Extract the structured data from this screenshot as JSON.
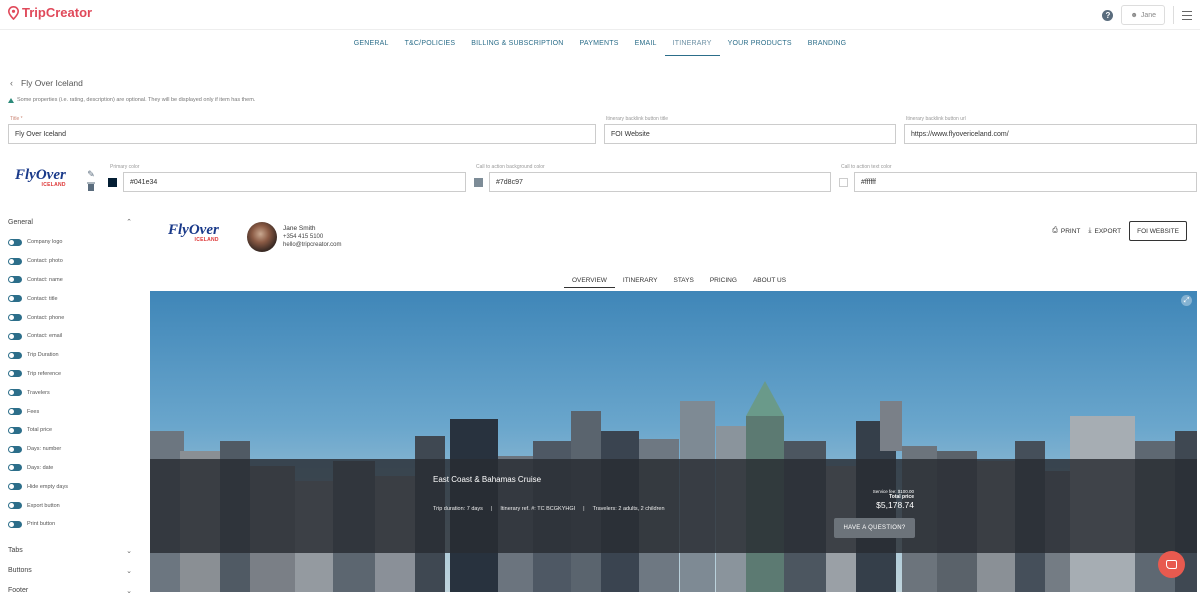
{
  "app": {
    "name": "TripCreator",
    "user": "Jane"
  },
  "nav": {
    "tabs": [
      "GENERAL",
      "T&C/POLICIES",
      "BILLING & SUBSCRIPTION",
      "PAYMENTS",
      "EMAIL",
      "ITINERARY",
      "YOUR PRODUCTS",
      "BRANDING"
    ],
    "active": "ITINERARY"
  },
  "page": {
    "title": "Fly Over Iceland",
    "note": "Some properties (i.e. rating, description) are optional. They will be displayed only if item has them."
  },
  "fields": {
    "title_label": "Title *",
    "title_value": "Fly Over Iceland",
    "backlink_title_label": "Itinerary backlink button title",
    "backlink_title_value": "FOI Website",
    "backlink_url_label": "Itinerary backlink button url",
    "backlink_url_value": "https://www.flyovericeland.com/",
    "primary_color_label": "Primary color",
    "primary_color_value": "#041e34",
    "cta_bg_label": "Call to action background color",
    "cta_bg_value": "#7d8c97",
    "cta_text_label": "Call to action text color",
    "cta_text_value": "#ffffff"
  },
  "brand_logo": {
    "main": "FlyOver",
    "sub": "ICELAND"
  },
  "sidebar": {
    "general_label": "General",
    "toggles": [
      "Company logo",
      "Contact: photo",
      "Contact: name",
      "Contact: title",
      "Contact: phone",
      "Contact: email",
      "Trip Duration",
      "Trip reference",
      "Travelers",
      "Fees",
      "Total price",
      "Days: number",
      "Days: date",
      "Hide empty days",
      "Export button",
      "Print button"
    ],
    "tabs_label": "Tabs",
    "buttons_label": "Buttons",
    "footer_label": "Footer"
  },
  "preview": {
    "contact_name": "Jane Smith",
    "contact_phone": "+354 415 5100",
    "contact_email": "hello@tripcreator.com",
    "print_label": "PRINT",
    "export_label": "EXPORT",
    "website_button": "FOI WEBSITE",
    "tabs": [
      "OVERVIEW",
      "ITINERARY",
      "STAYS",
      "PRICING",
      "ABOUT US"
    ],
    "active_tab": "OVERVIEW",
    "trip_name": "East Coast & Bahamas Cruise",
    "trip_duration": "Trip duration: 7 days",
    "itinerary_ref": "Itinerary ref. #: TC BCGKYHGI",
    "travelers": "Travelers: 2 adults, 2 children",
    "service_fee": "Service fee: $100.00",
    "total_price_label": "Total price",
    "total_price": "$5,178.74",
    "question_button": "HAVE A QUESTION?"
  },
  "colors": {
    "primary": "#041e34",
    "cta_bg": "#7d8c97",
    "cta_text": "#ffffff",
    "brand": "#e0495a",
    "accent": "#2c6e8a"
  }
}
